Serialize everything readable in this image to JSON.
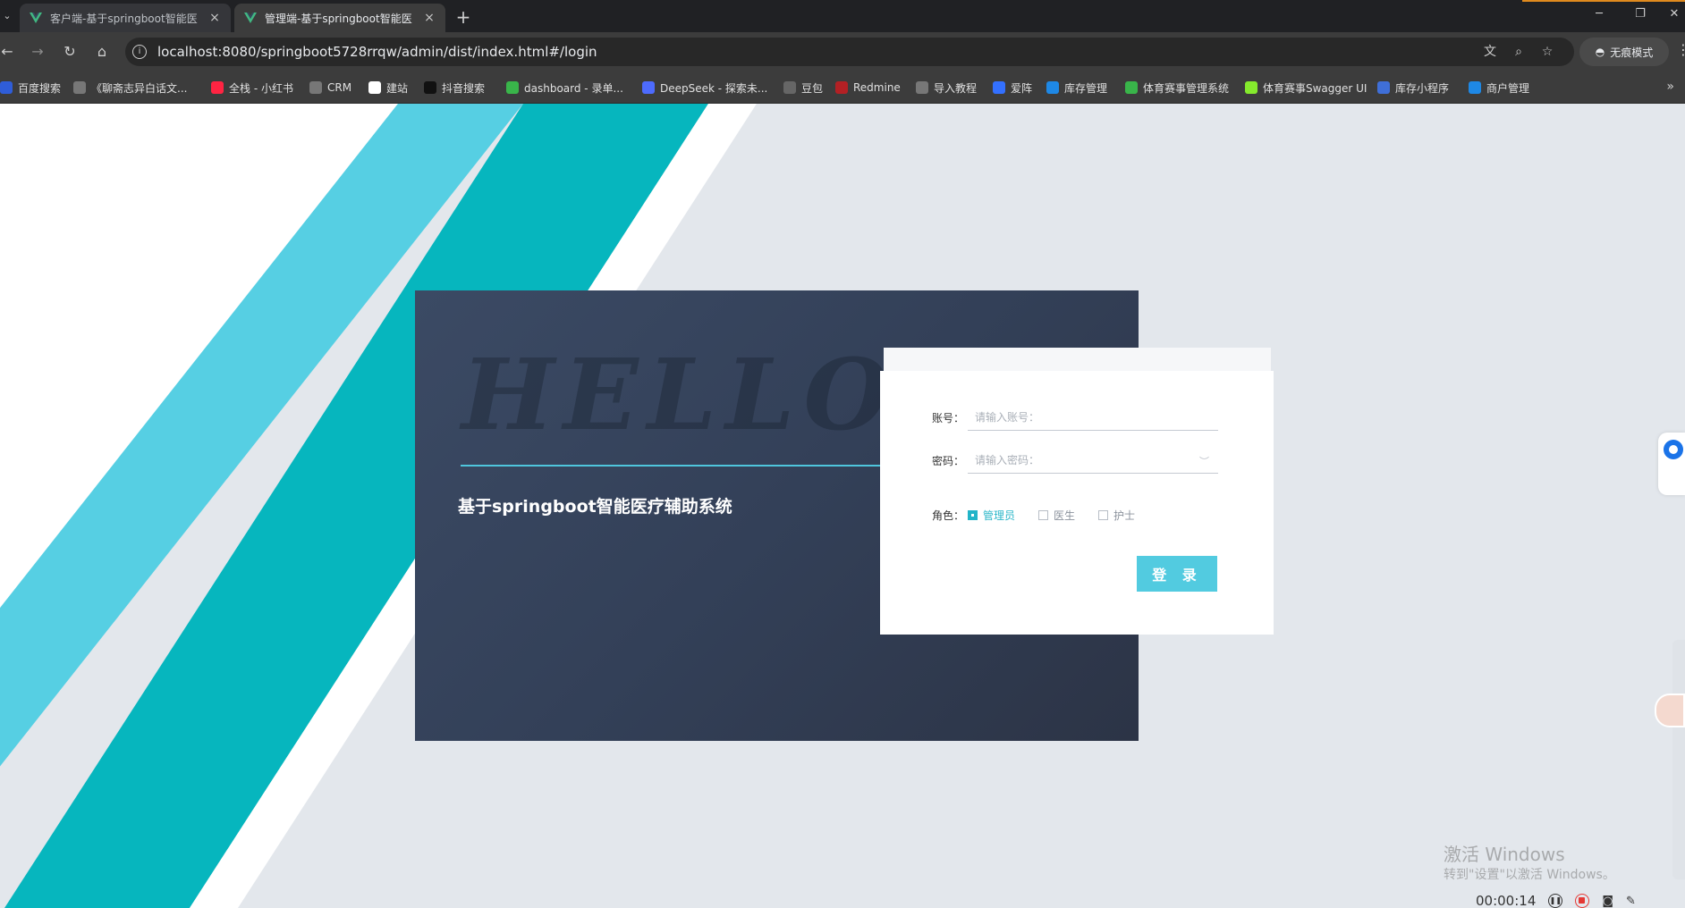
{
  "browser": {
    "tab_menu_icon": "chevron-down",
    "tabs": [
      {
        "title": "客户端-基于springboot智能医",
        "close": "×",
        "favicon_color": "#41b883"
      },
      {
        "title": "管理端-基于springboot智能医",
        "close": "×",
        "favicon_color": "#41b883"
      }
    ],
    "new_tab": "+",
    "window_controls": {
      "minimize": "─",
      "restore": "❐",
      "close": "✕"
    },
    "url": "localhost:8080/springboot5728rrqw/admin/dist/index.html#/login",
    "incognito_label": "无痕模式",
    "bookmarks": [
      {
        "label": "百度搜索",
        "color": "#2f5dd8"
      },
      {
        "label": "《聊斋志异白话文...",
        "color": "#777777"
      },
      {
        "label": "全栈 - 小红书",
        "color": "#ff2442"
      },
      {
        "label": "CRM",
        "color": "#777777"
      },
      {
        "label": "建站",
        "color": "#ffffff"
      },
      {
        "label": "抖音搜索",
        "color": "#111111"
      },
      {
        "label": "dashboard - 录单...",
        "color": "#39b54a"
      },
      {
        "label": "DeepSeek - 探索未...",
        "color": "#4d6bfe"
      },
      {
        "label": "豆包",
        "color": "#666666"
      },
      {
        "label": "Redmine",
        "color": "#b32024"
      },
      {
        "label": "导入教程",
        "color": "#777777"
      },
      {
        "label": "爱阵",
        "color": "#3370ff"
      },
      {
        "label": "库存管理",
        "color": "#1e88e5"
      },
      {
        "label": "体育赛事管理系统",
        "color": "#39b54a"
      },
      {
        "label": "体育赛事Swagger UI",
        "color": "#85ea2d"
      },
      {
        "label": "库存小程序",
        "color": "#3f6fd8"
      },
      {
        "label": "商户管理",
        "color": "#1e88e5"
      }
    ]
  },
  "page": {
    "hello_text": "HELLO",
    "system_title": "基于springboot智能医疗辅助系统",
    "form": {
      "account_label": "账号：",
      "account_placeholder": "请输入账号：",
      "password_label": "密码：",
      "password_placeholder": "请输入密码：",
      "role_label": "角色：",
      "roles": [
        {
          "label": "管理员",
          "checked": true
        },
        {
          "label": "医生",
          "checked": false
        },
        {
          "label": "护士",
          "checked": false
        }
      ],
      "login_button": "登 录"
    },
    "colors": {
      "accent": "#52cbe0",
      "stripe_light": "#56cfe3",
      "stripe_dark": "#06b6be",
      "panel": "#354259"
    }
  },
  "os": {
    "activate_title": "激活 Windows",
    "activate_subtitle": "转到\"设置\"以激活 Windows。",
    "recording_time": "00:00:14"
  }
}
